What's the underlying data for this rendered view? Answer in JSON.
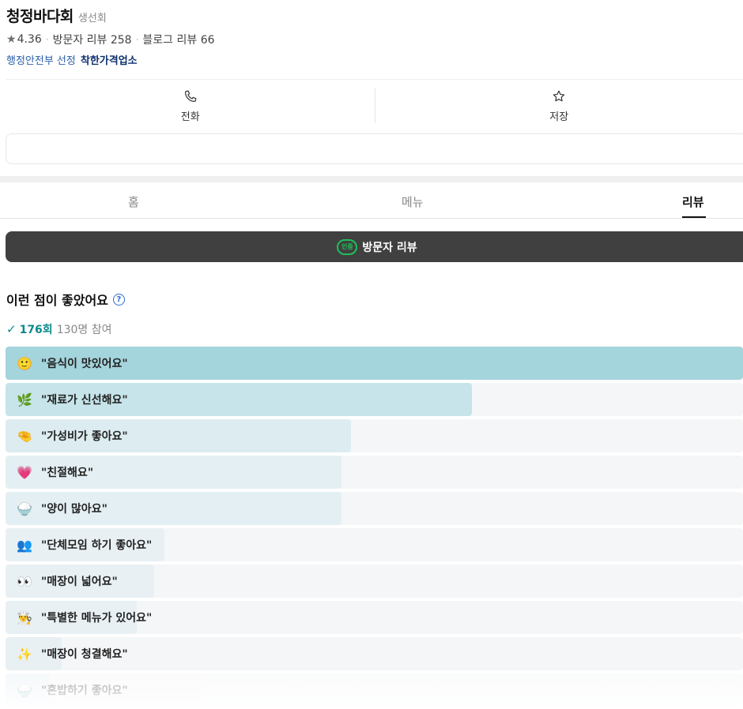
{
  "place": {
    "name": "청정바다회",
    "category": "생선회",
    "rating_star": "★",
    "rating": "4.36",
    "visitor_reviews": "방문자 리뷰 258",
    "blog_reviews": "블로그 리뷰 66",
    "badge_prefix": "행정안전부 선정",
    "badge_name": "착한가격업소"
  },
  "actions": [
    {
      "label": "전화",
      "icon": "phone-icon"
    },
    {
      "label": "저장",
      "icon": "star-icon"
    }
  ],
  "tabs": [
    {
      "label": "홈",
      "active": false
    },
    {
      "label": "메뉴",
      "active": false
    },
    {
      "label": "리뷰",
      "active": true
    }
  ],
  "visitor_bar": {
    "cert_text": "인증",
    "label": "방문자 리뷰"
  },
  "likes": {
    "title": "이런 점이 좋았어요",
    "help_symbol": "?",
    "check_symbol": "✓",
    "count": "176회",
    "participants": "130명 참여",
    "items": [
      {
        "emoji": "🙂",
        "label": "\"음식이 맛있어요\"",
        "ratio": 1.0,
        "color": "#a4d4dc"
      },
      {
        "emoji": "🌿",
        "label": "\"재료가 신선해요\"",
        "ratio": 0.632,
        "color": "#c6e4e9"
      },
      {
        "emoji": "🤏",
        "label": "\"가성비가 좋아요\"",
        "ratio": 0.468,
        "color": "#dcecf0"
      },
      {
        "emoji": "💗",
        "label": "\"친절해요\"",
        "ratio": 0.456,
        "color": "#e4eff3"
      },
      {
        "emoji": "🍚",
        "label": "\"양이 많아요\"",
        "ratio": 0.456,
        "color": "#e4eff3"
      },
      {
        "emoji": "👥",
        "label": "\"단체모임 하기 좋아요\"",
        "ratio": 0.215,
        "color": "#e8f0f4"
      },
      {
        "emoji": "👀",
        "label": "\"매장이 넓어요\"",
        "ratio": 0.202,
        "color": "#e8f0f4"
      },
      {
        "emoji": "👨‍🍳",
        "label": "\"특별한 메뉴가 있어요\"",
        "ratio": 0.178,
        "color": "#e8f0f4"
      },
      {
        "emoji": "✨",
        "label": "\"매장이 청결해요\"",
        "ratio": 0.076,
        "color": "#e8f0f4"
      },
      {
        "emoji": "🍚",
        "label": "\"혼밥하기 좋아요\"",
        "ratio": 0.06,
        "color": "#e8f0f4"
      }
    ]
  }
}
